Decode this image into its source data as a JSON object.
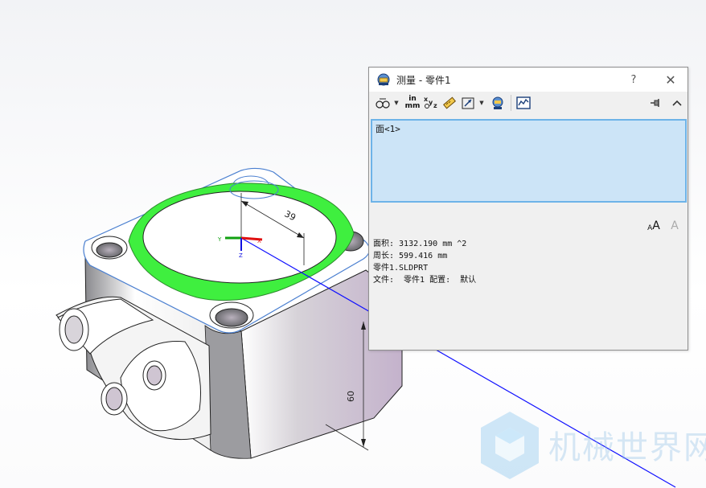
{
  "viewport": {
    "dimension_radius": "39",
    "dimension_height": "60",
    "triad": {
      "x": "X",
      "y": "Y",
      "z": "Z"
    }
  },
  "dialog": {
    "title": "测量 - 零件1",
    "help_label": "?",
    "close_label": "✕",
    "toolbar": {
      "units_in": "in",
      "units_mm": "mm",
      "xyz_label": "xyz"
    },
    "selection": [
      "面<1>"
    ],
    "results": {
      "area": "面积: 3132.190 mm ^2",
      "perimeter": "周长: 599.416 mm",
      "part": "零件1.SLDPRT",
      "file": "文件:  零件1 配置:  默认"
    },
    "font_increase": "A",
    "font_decrease": "A"
  },
  "watermark": {
    "text": "机械世界网"
  },
  "colors": {
    "selection_bg": "#cce4f7",
    "selection_border": "#6db3e8",
    "highlight_face": "#3fef3f",
    "axis_line": "#1010ff",
    "body_shade": "#c9b7cf"
  }
}
